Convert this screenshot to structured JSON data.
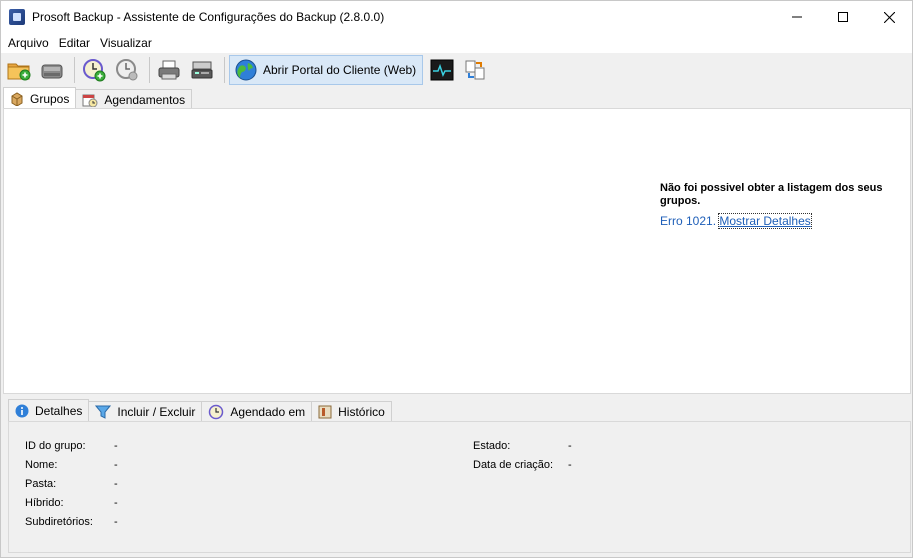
{
  "window": {
    "title": "Prosoft Backup - Assistente de Configurações do Backup (2.8.0.0)"
  },
  "menu": [
    "Arquivo",
    "Editar",
    "Visualizar"
  ],
  "toolbar": {
    "portal_label": "Abrir Portal do Cliente (Web)"
  },
  "tabs_top": [
    {
      "label": "Grupos",
      "icon": "box-icon",
      "active": true
    },
    {
      "label": "Agendamentos",
      "icon": "calendar-icon",
      "active": false
    }
  ],
  "error": {
    "title": "Não foi possivel obter a listagem dos seus grupos.",
    "code": "Erro 1021.",
    "link": "Mostrar Detalhes"
  },
  "tabs_bottom": [
    {
      "label": "Detalhes",
      "icon": "info-icon",
      "active": true
    },
    {
      "label": "Incluir / Excluir",
      "icon": "filter-icon",
      "active": false
    },
    {
      "label": "Agendado em",
      "icon": "clock-icon",
      "active": false
    },
    {
      "label": "Histórico",
      "icon": "history-icon",
      "active": false
    }
  ],
  "details": {
    "left": [
      {
        "label": "ID do grupo:",
        "value": "-"
      },
      {
        "label": "Nome:",
        "value": "-"
      },
      {
        "label": "Pasta:",
        "value": "-"
      },
      {
        "label": "Híbrido:",
        "value": "-"
      },
      {
        "label": "Subdiretórios:",
        "value": "-"
      }
    ],
    "right": [
      {
        "label": "Estado:",
        "value": "-"
      },
      {
        "label": "Data de criação:",
        "value": "-"
      }
    ]
  }
}
